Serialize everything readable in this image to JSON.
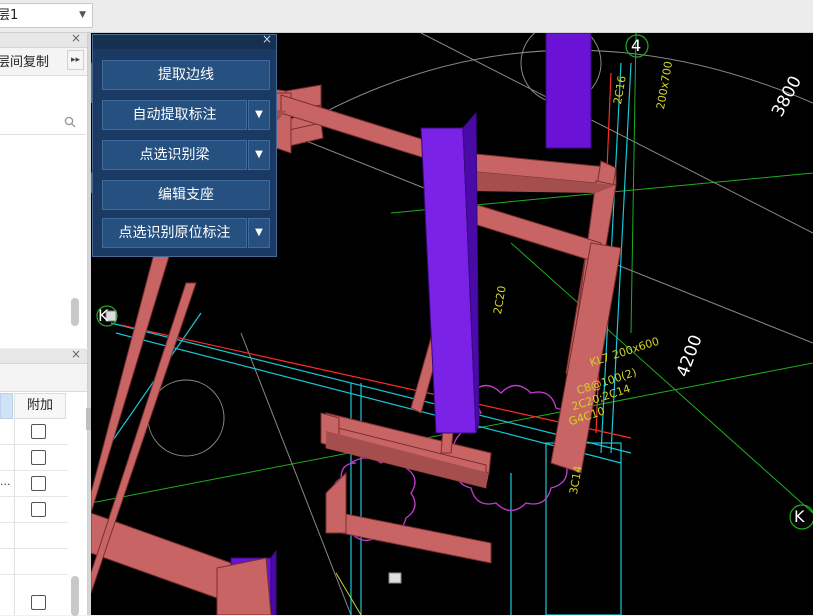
{
  "toolbar": {
    "floor_select_value": "层1"
  },
  "left_panel_top": {
    "copy_label": "层间复制",
    "more_icon": "double-chevron-right-icon",
    "search_icon": "search-icon"
  },
  "left_panel_bottom": {
    "column_header": "附加",
    "rows": [
      {
        "prefix": "",
        "checked": false
      },
      {
        "prefix": "",
        "checked": false
      },
      {
        "prefix": "...",
        "checked": false
      },
      {
        "prefix": "",
        "checked": false
      }
    ]
  },
  "float_panel": {
    "buttons": [
      {
        "label": "提取边线",
        "dropdown": false
      },
      {
        "label": "自动提取标注",
        "dropdown": true
      },
      {
        "label": "点选识别梁",
        "dropdown": true
      },
      {
        "label": "编辑支座",
        "dropdown": false
      },
      {
        "label": "点选识别原位标注",
        "dropdown": true
      }
    ]
  },
  "cad": {
    "axis_labels": [
      "4",
      "K",
      "K"
    ],
    "dimensions": [
      "3800",
      "4200"
    ],
    "annotations": [
      "KL7 200x600",
      "C8@100(2)",
      "2C20;2C14",
      "G4C10",
      "2C16",
      "200x700",
      "2C20",
      "3C14"
    ]
  },
  "colors": {
    "beam": "#c96464",
    "column": "#6a12d6",
    "panel_bg": "#1b3a63",
    "button_bg": "#26507f"
  }
}
